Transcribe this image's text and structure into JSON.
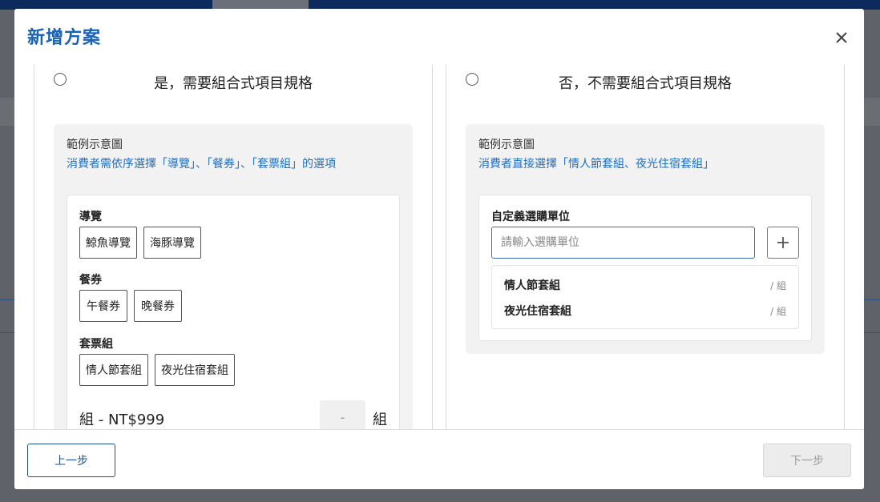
{
  "modal": {
    "title": "新增方案",
    "close_icon": "close-icon"
  },
  "options": {
    "yes": {
      "title": "是，需要組合式項目規格",
      "example_label": "範例示意圖",
      "example_desc": "消費者需依序選擇「導覽」、「餐券」、「套票組」的選項",
      "groups": [
        {
          "title": "導覽",
          "chips": [
            "鯨魚導覽",
            "海豚導覽"
          ]
        },
        {
          "title": "餐券",
          "chips": [
            "午餐券",
            "晚餐券"
          ]
        },
        {
          "title": "套票組",
          "chips": [
            "情人節套組",
            "夜光住宿套組"
          ]
        }
      ],
      "price_text": "組 - NT$999",
      "qty_placeholder": "-",
      "unit": "組"
    },
    "no": {
      "title": "否，不需要組合式項目規格",
      "example_label": "範例示意圖",
      "example_desc": "消費者直接選擇「情人節套組、夜光住宿套組」",
      "custom_title": "自定義選購單位",
      "input_placeholder": "請輸入選購單位",
      "input_value": "",
      "add_icon": "plus-icon",
      "units": [
        {
          "name": "情人節套組",
          "suffix": "/ 組"
        },
        {
          "name": "夜光住宿套組",
          "suffix": "/ 組"
        }
      ]
    }
  },
  "footer": {
    "prev_label": "上一步",
    "next_label": "下一步"
  },
  "colors": {
    "title_blue": "#1862b7",
    "link_blue": "#1a6fc9",
    "prev_border": "#1d4f91",
    "disabled_bg": "#ececec"
  }
}
